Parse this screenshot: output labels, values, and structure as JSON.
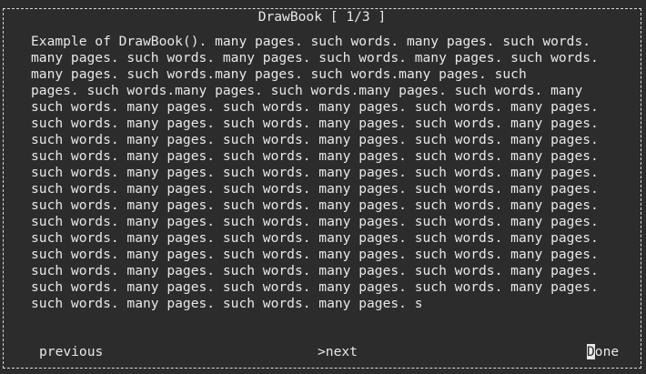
{
  "window": {
    "title": "DrawBook [ 1/3 ]"
  },
  "book": {
    "lines": [
      "Example of DrawBook(). many pages. such words. many pages. such words.",
      "many pages. such words. many pages. such words. many pages. such words.",
      "many pages. such words.many pages. such words.many pages. such",
      "pages. such words.many pages. such words.many pages. such words. many",
      "such words. many pages. such words. many pages. such words. many pages.",
      "such words. many pages. such words. many pages. such words. many pages.",
      "such words. many pages. such words. many pages. such words. many pages.",
      "such words. many pages. such words. many pages. such words. many pages.",
      "such words. many pages. such words. many pages. such words. many pages.",
      "such words. many pages. such words. many pages. such words. many pages.",
      "such words. many pages. such words. many pages. such words. many pages.",
      "such words. many pages. such words. many pages. such words. many pages.",
      "such words. many pages. such words. many pages. such words. many pages.",
      "such words. many pages. such words. many pages. such words. many pages.",
      "such words. many pages. such words. many pages. such words. many pages.",
      "such words. many pages. such words. many pages. such words. many pages.",
      "such words. many pages. such words. many pages. s"
    ]
  },
  "footer": {
    "previous_label": "previous",
    "next_label": ">next",
    "done_first_char": "D",
    "done_rest": "one"
  },
  "colors": {
    "background": "#2c2c2c",
    "foreground": "#e8e8e8"
  }
}
